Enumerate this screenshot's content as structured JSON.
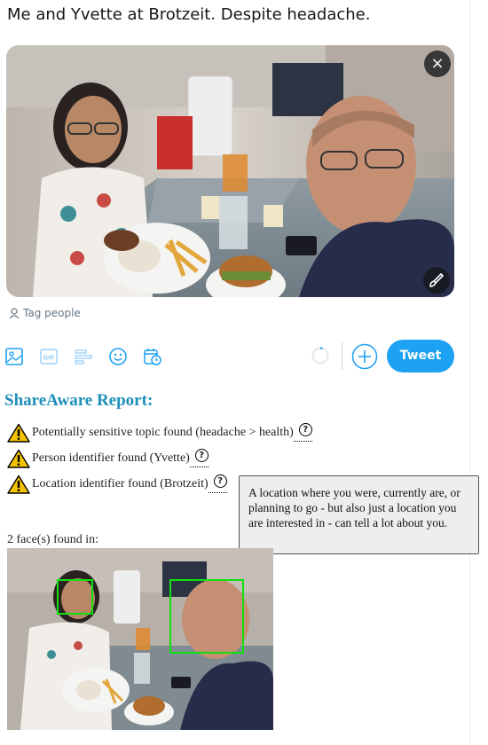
{
  "tweet": {
    "text": "Me and Yvette at Brotzeit. Despite headache.",
    "close_icon": "×",
    "tag_people": "Tag people"
  },
  "toolbar": {
    "icons": [
      "image-icon",
      "gif-icon",
      "poll-icon",
      "emoji-icon",
      "schedule-icon"
    ],
    "gif_label": "GIF",
    "tweet_label": "Tweet",
    "accent": "#1da1f2"
  },
  "report": {
    "title": "ShareAware Report:",
    "title_color": "#1d8fb8",
    "findings": [
      {
        "text": "Potentially sensitive topic found (headache > health)"
      },
      {
        "text": "Person identifier found (Yvette)"
      },
      {
        "text": "Location identifier found (Brotzeit)"
      }
    ],
    "qmark": "?",
    "tooltip": "A location where you were, currently are, or planning to go - but also just a location you are interested in - can tell a lot about you.",
    "faces_label": "2 face(s) found in:"
  }
}
